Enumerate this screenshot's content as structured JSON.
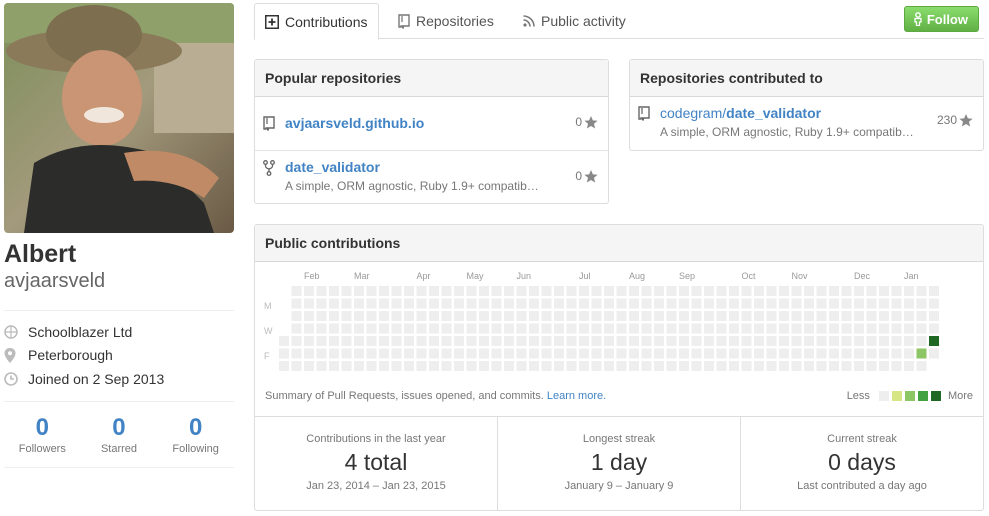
{
  "profile": {
    "fullname": "Albert",
    "username": "avjaarsveld",
    "organization": "Schoolblazer Ltd",
    "location": "Peterborough",
    "joined": "Joined on 2 Sep 2013",
    "stats": [
      {
        "value": "0",
        "label": "Followers"
      },
      {
        "value": "0",
        "label": "Starred"
      },
      {
        "value": "0",
        "label": "Following"
      }
    ]
  },
  "tabs": [
    {
      "label": "Contributions",
      "icon": "contributions-icon",
      "selected": true
    },
    {
      "label": "Repositories",
      "icon": "repo-icon",
      "selected": false
    },
    {
      "label": "Public activity",
      "icon": "rss-icon",
      "selected": false
    }
  ],
  "follow_label": "Follow",
  "popular": {
    "title": "Popular repositories",
    "repos": [
      {
        "name": "avjaarsveld.github.io",
        "description": "",
        "stars": "0",
        "icon": "repo-icon"
      },
      {
        "name": "date_validator",
        "description": "A simple, ORM agnostic, Ruby 1.9+ compatib…",
        "stars": "0",
        "icon": "fork-icon"
      }
    ]
  },
  "contributed": {
    "title": "Repositories contributed to",
    "repos": [
      {
        "owner": "codegram/",
        "name": "date_validator",
        "description": "A simple, ORM agnostic, Ruby 1.9+ compatib…",
        "stars": "230",
        "icon": "repo-icon"
      }
    ]
  },
  "public_contributions": {
    "title": "Public contributions",
    "months": [
      "Feb",
      "Mar",
      "Apr",
      "May",
      "Jun",
      "Jul",
      "Aug",
      "Sep",
      "Oct",
      "Nov",
      "Dec",
      "Jan"
    ],
    "day_labels": [
      "M",
      "W",
      "F"
    ],
    "summary_text": "Summary of Pull Requests, issues opened, and commits.",
    "learn_more": "Learn more.",
    "legend_less": "Less",
    "legend_more": "More",
    "colors": {
      "empty": "#eeeeee",
      "level1": "#d6e685",
      "level2": "#8cc665",
      "level3": "#44a340",
      "level4": "#1e6823"
    },
    "active_cells": [
      {
        "week_from_end": 1,
        "day": 5,
        "level": 2
      },
      {
        "week_from_end": 0,
        "day": 4,
        "level": 4
      }
    ],
    "stats": [
      {
        "title": "Contributions in the last year",
        "value": "4 total",
        "sub": "Jan 23, 2014 – Jan 23, 2015"
      },
      {
        "title": "Longest streak",
        "value": "1 day",
        "sub": "January 9 – January 9"
      },
      {
        "title": "Current streak",
        "value": "0 days",
        "sub": "Last contributed a day ago"
      }
    ]
  }
}
